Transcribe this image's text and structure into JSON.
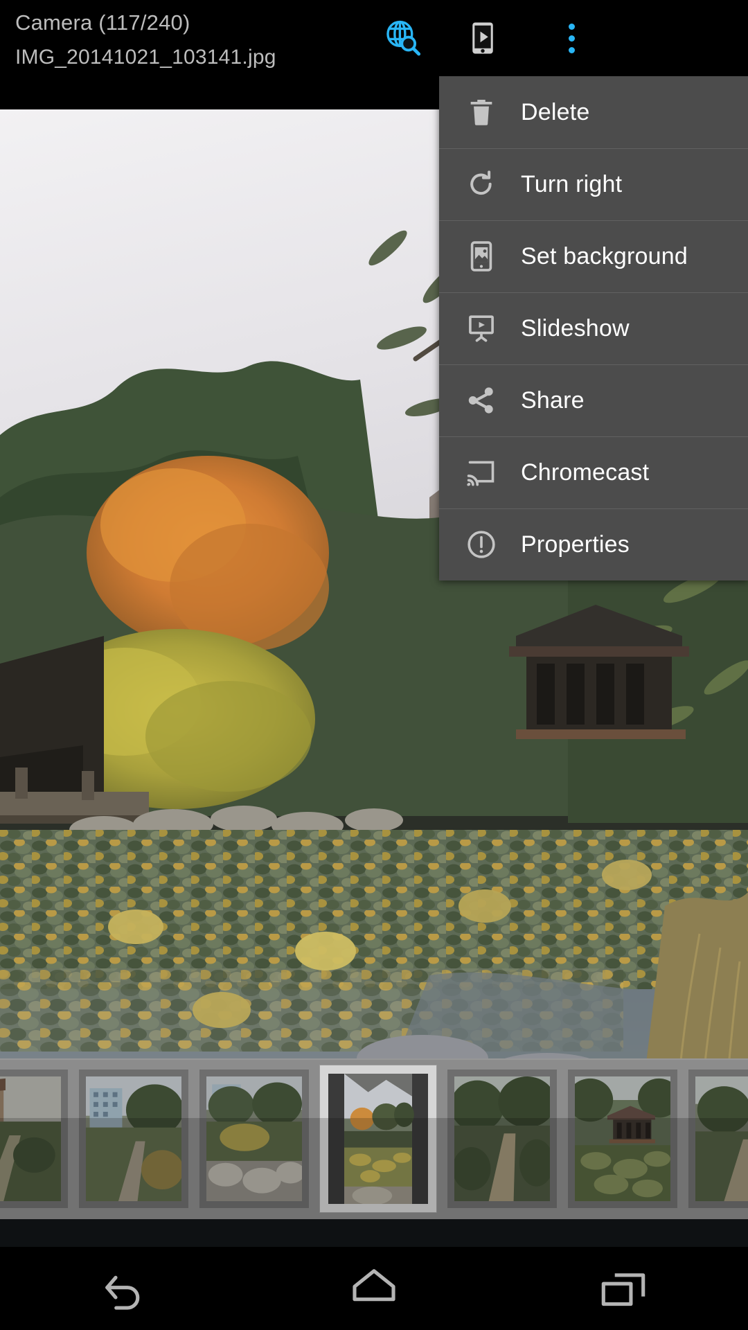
{
  "app": {
    "album_title": "Camera (117/240)",
    "file_name": "IMG_20141021_103141.jpg",
    "photo_index": 117,
    "photo_count": 240
  },
  "action_bar": {
    "icons": [
      {
        "name": "web-search-icon",
        "label": "Web search",
        "color": "#29b6f6"
      },
      {
        "name": "cast-to-device-icon",
        "label": "Play on device",
        "color": "#cfcfcf"
      },
      {
        "name": "overflow-menu-icon",
        "label": "More options",
        "color": "#29b6f6"
      }
    ]
  },
  "menu": {
    "open": true,
    "background": "#4c4c4c",
    "divider": "#616161",
    "text_color": "#ffffff",
    "items": [
      {
        "label": "Delete",
        "icon": "trash-icon"
      },
      {
        "label": "Turn right",
        "icon": "rotate-right-icon"
      },
      {
        "label": "Set background",
        "icon": "set-wallpaper-icon"
      },
      {
        "label": "Slideshow",
        "icon": "slideshow-icon"
      },
      {
        "label": "Share",
        "icon": "share-icon"
      },
      {
        "label": "Chromecast",
        "icon": "chromecast-icon"
      },
      {
        "label": "Properties",
        "icon": "info-icon"
      }
    ]
  },
  "photo": {
    "description": "Chinese garden pond covered in lily pads with autumn trees and a pavilion",
    "sky_color": "#e8e6ea",
    "water_color": "#63707a",
    "foliage_color": "#3c4a32"
  },
  "filmstrip": {
    "background": "#8c8c8c",
    "selected_index": 3,
    "thumbnails": [
      {
        "name": "thumb-building-garden",
        "selected": false,
        "tint": "#6a6a5e"
      },
      {
        "name": "thumb-apartment-path",
        "selected": false,
        "tint": "#7a8170"
      },
      {
        "name": "thumb-rock-garden",
        "selected": false,
        "tint": "#6d7365"
      },
      {
        "name": "thumb-lilypad-pond",
        "selected": true,
        "tint": "#7f8a74"
      },
      {
        "name": "thumb-forest-path",
        "selected": false,
        "tint": "#5f6b56"
      },
      {
        "name": "thumb-pavilion-pond",
        "selected": false,
        "tint": "#5d6a52"
      },
      {
        "name": "thumb-partial-right",
        "selected": false,
        "tint": "#6a7060"
      }
    ]
  },
  "navbar": {
    "background": "#000000",
    "icon_color": "#b4b4b4",
    "buttons": [
      {
        "name": "back-button",
        "label": "Back"
      },
      {
        "name": "home-button",
        "label": "Home"
      },
      {
        "name": "recents-button",
        "label": "Recent apps"
      }
    ]
  }
}
